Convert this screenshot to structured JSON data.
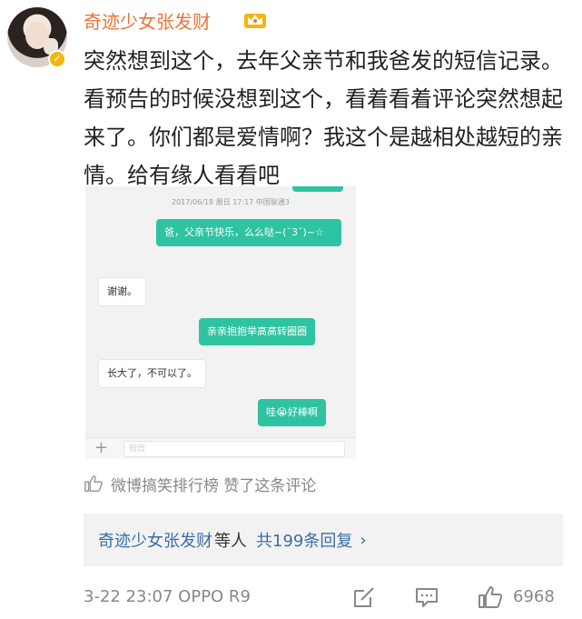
{
  "post": {
    "username": "奇迹少女张发财",
    "comment_text": "突然想到这个，去年父亲节和我爸发的短信记录。看预告的时候没想到这个，看着看着评论突然想起来了。你们都是爱情啊？我这个是越相处越短的亲情。给有缘人看看吧",
    "liked_by": "微博搞笑排行榜 赞了这条评论",
    "replies": {
      "names": "奇迹少女张发财",
      "suffix": "等人",
      "count_text": "共199条回复",
      "chevron": "›"
    },
    "footer": {
      "time_device": "3-22 23:07 OPPO R9",
      "likes": "6968"
    },
    "icons": [
      "verified-badge-icon",
      "crown-icon",
      "thumbs-up-icon",
      "share-icon",
      "comment-icon",
      "like-icon"
    ]
  },
  "sms": {
    "meta": "2017/06/18  周日  17:17  中国联通3",
    "messages": [
      {
        "side": "out",
        "text": "爸，父亲节快乐，么么哒~(˘3˘)~☆"
      },
      {
        "side": "in",
        "text": "谢谢。"
      },
      {
        "side": "out",
        "text": "亲亲抱抱举高高转圈圈"
      },
      {
        "side": "in",
        "text": "长大了，不可以了。"
      },
      {
        "side": "out",
        "text": "哇😭好棒啊"
      }
    ],
    "input_placeholder": "短信",
    "plus": "+"
  },
  "colors": {
    "username": "#e8743b",
    "bubble_out": "#2ec3a1",
    "link_blue": "#3a6ea5",
    "badge": "#f5b60a"
  }
}
